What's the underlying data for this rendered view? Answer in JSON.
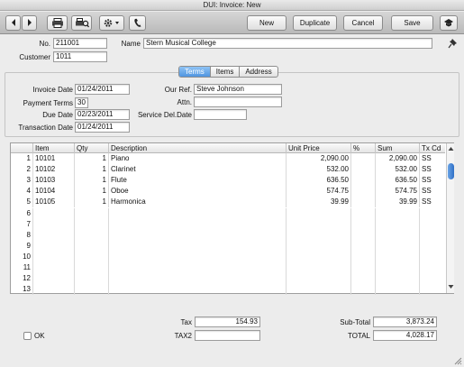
{
  "window": {
    "title": "DUI: Invoice: New"
  },
  "toolbar": {
    "new_label": "New",
    "duplicate_label": "Duplicate",
    "cancel_label": "Cancel",
    "save_label": "Save"
  },
  "header": {
    "no_label": "No.",
    "no_value": "211001",
    "name_label": "Name",
    "name_value": "Stern Musical College",
    "customer_label": "Customer",
    "customer_value": "1011"
  },
  "tabs": [
    "Terms",
    "Items",
    "Address"
  ],
  "terms": {
    "invoice_date_label": "Invoice Date",
    "invoice_date": "01/24/2011",
    "payment_terms_label": "Payment Terms",
    "payment_terms": "30",
    "due_date_label": "Due Date",
    "due_date": "02/23/2011",
    "transaction_date_label": "Transaction Date",
    "transaction_date": "01/24/2011",
    "our_ref_label": "Our Ref.",
    "our_ref": "Steve Johnson",
    "attn_label": "Attn.",
    "attn": "",
    "service_del_date_label": "Service Del.Date",
    "service_del_date": ""
  },
  "grid": {
    "columns": [
      "Item",
      "Qty",
      "Description",
      "Unit Price",
      "%",
      "Sum",
      "Tx Cd"
    ],
    "row_numbers": [
      "1",
      "2",
      "3",
      "4",
      "5",
      "6",
      "7",
      "8",
      "9",
      "10",
      "11",
      "12",
      "13"
    ],
    "rows": [
      {
        "item": "10101",
        "qty": "1",
        "description": "Piano",
        "unit_price": "2,090.00",
        "pct": "",
        "sum": "2,090.00",
        "tx": "SS"
      },
      {
        "item": "10102",
        "qty": "1",
        "description": "Clarinet",
        "unit_price": "532.00",
        "pct": "",
        "sum": "532.00",
        "tx": "SS"
      },
      {
        "item": "10103",
        "qty": "1",
        "description": "Flute",
        "unit_price": "636.50",
        "pct": "",
        "sum": "636.50",
        "tx": "SS"
      },
      {
        "item": "10104",
        "qty": "1",
        "description": "Oboe",
        "unit_price": "574.75",
        "pct": "",
        "sum": "574.75",
        "tx": "SS"
      },
      {
        "item": "10105",
        "qty": "1",
        "description": "Harmonica",
        "unit_price": "39.99",
        "pct": "",
        "sum": "39.99",
        "tx": "SS"
      }
    ]
  },
  "footer": {
    "ok_label": "OK",
    "tax_label": "Tax",
    "tax_value": "154.93",
    "tax2_label": "TAX2",
    "tax2_value": "",
    "subtotal_label": "Sub-Total",
    "subtotal_value": "3,873.24",
    "total_label": "TOTAL",
    "total_value": "4,028.17"
  },
  "icons": [
    "back-arrow-icon",
    "forward-arrow-icon",
    "printer-icon",
    "print-preview-icon",
    "gear-icon",
    "phone-icon",
    "pin-icon",
    "toggle-toolbar-icon"
  ]
}
